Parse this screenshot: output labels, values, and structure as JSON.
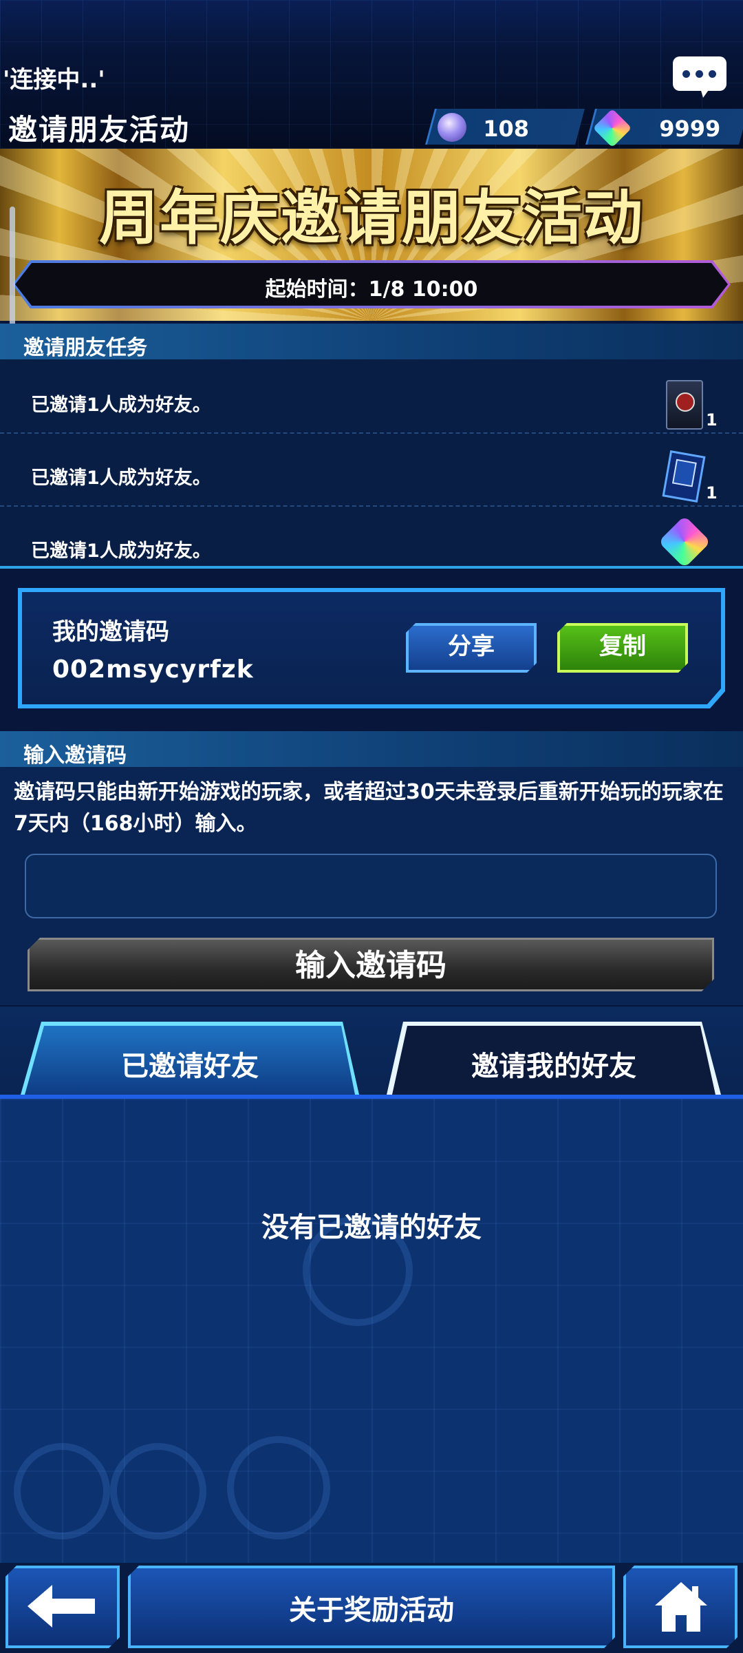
{
  "header": {
    "status": "'连接中..'",
    "title": "邀请朋友活动",
    "currencies": [
      {
        "icon": "orb-icon",
        "value": "108"
      },
      {
        "icon": "gem-icon",
        "value": "9999"
      }
    ]
  },
  "banner": {
    "title": "周年庆邀请朋友活动",
    "start_time": "起始时间：1/8 10:00"
  },
  "missions": {
    "header": "邀请朋友任务",
    "items": [
      {
        "text": "已邀请1人成为好友。",
        "reward_icon": "deck-case-icon",
        "count": "1"
      },
      {
        "text": "已邀请1人成为好友。",
        "reward_icon": "card-sleeve-icon",
        "count": "1"
      },
      {
        "text": "已邀请1人成为好友。",
        "reward_icon": "gem-icon",
        "count": ""
      }
    ]
  },
  "my_code": {
    "label": "我的邀请码",
    "value": "002msycyrfzk",
    "share_label": "分享",
    "copy_label": "复制"
  },
  "enter_code": {
    "header": "输入邀请码",
    "description": "邀请码只能由新开始游戏的玩家，或者超过30天未登录后重新开始玩的玩家在7天内（168小时）输入。",
    "input_value": "",
    "button_label": "输入邀请码"
  },
  "tabs": [
    {
      "label": "已邀请好友",
      "selected": true
    },
    {
      "label": "邀请我的好友",
      "selected": false
    }
  ],
  "list": {
    "empty_text": "没有已邀请的好友"
  },
  "footer": {
    "reward_label": "关于奖励活动"
  },
  "colors": {
    "accent_blue": "#2fa7ff",
    "copy_green": "#59c419",
    "banner_gold": "#e2b63b"
  }
}
